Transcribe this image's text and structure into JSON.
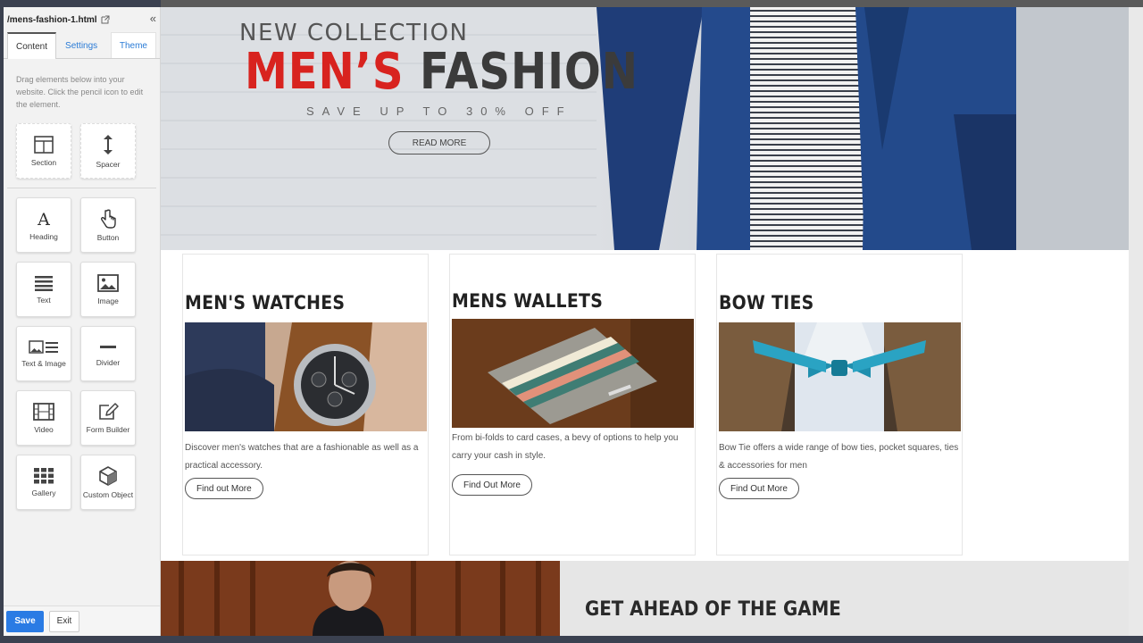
{
  "sidebar": {
    "file_name": "/mens-fashion-1.html",
    "collapse_glyph": "«",
    "tabs": [
      {
        "label": "Content"
      },
      {
        "label": "Settings"
      },
      {
        "label": "Theme"
      }
    ],
    "help_text": "Drag elements below into your website. Click the pencil icon to edit the element.",
    "layout_blocks": [
      {
        "label": "Section",
        "icon": "section-icon"
      },
      {
        "label": "Spacer",
        "icon": "spacer-icon"
      }
    ],
    "content_blocks": [
      {
        "label": "Heading",
        "icon": "heading-icon"
      },
      {
        "label": "Button",
        "icon": "pointer-hand-icon"
      },
      {
        "label": "Text",
        "icon": "text-lines-icon"
      },
      {
        "label": "Image",
        "icon": "image-icon"
      },
      {
        "label": "Text & Image",
        "icon": "text-image-icon"
      },
      {
        "label": "Divider",
        "icon": "divider-icon"
      },
      {
        "label": "Video",
        "icon": "film-icon"
      },
      {
        "label": "Form Builder",
        "icon": "edit-form-icon"
      },
      {
        "label": "Gallery",
        "icon": "gallery-grid-icon"
      },
      {
        "label": "Custom Object",
        "icon": "cube-icon"
      }
    ],
    "save_label": "Save",
    "exit_label": "Exit"
  },
  "hero": {
    "kicker": "NEW COLLECTION",
    "title_red": "MEN’S",
    "title_dark": "FASHION",
    "offer": "SAVE UP TO 30% OFF",
    "cta": "READ MORE"
  },
  "cards": [
    {
      "title": "MEN'S WATCHES",
      "text": "Discover men's watches that are a fashionable as well as a practical accessory.",
      "button": "Find out More"
    },
    {
      "title": "MENS WALLETS",
      "text": "From bi-folds to card cases, a bevy of options to help you carry your cash in style.",
      "button": "Find Out More"
    },
    {
      "title": "BOW TIES",
      "text": "Bow Tie offers a wide range of bow ties, pocket squares, ties & accessories for men",
      "button": "Find Out More"
    }
  ],
  "bottom": {
    "heading": "GET AHEAD OF THE GAME"
  },
  "colors": {
    "accent_red": "#d8231f",
    "save_blue": "#2a7be4",
    "tab_link": "#2a7bd6"
  }
}
